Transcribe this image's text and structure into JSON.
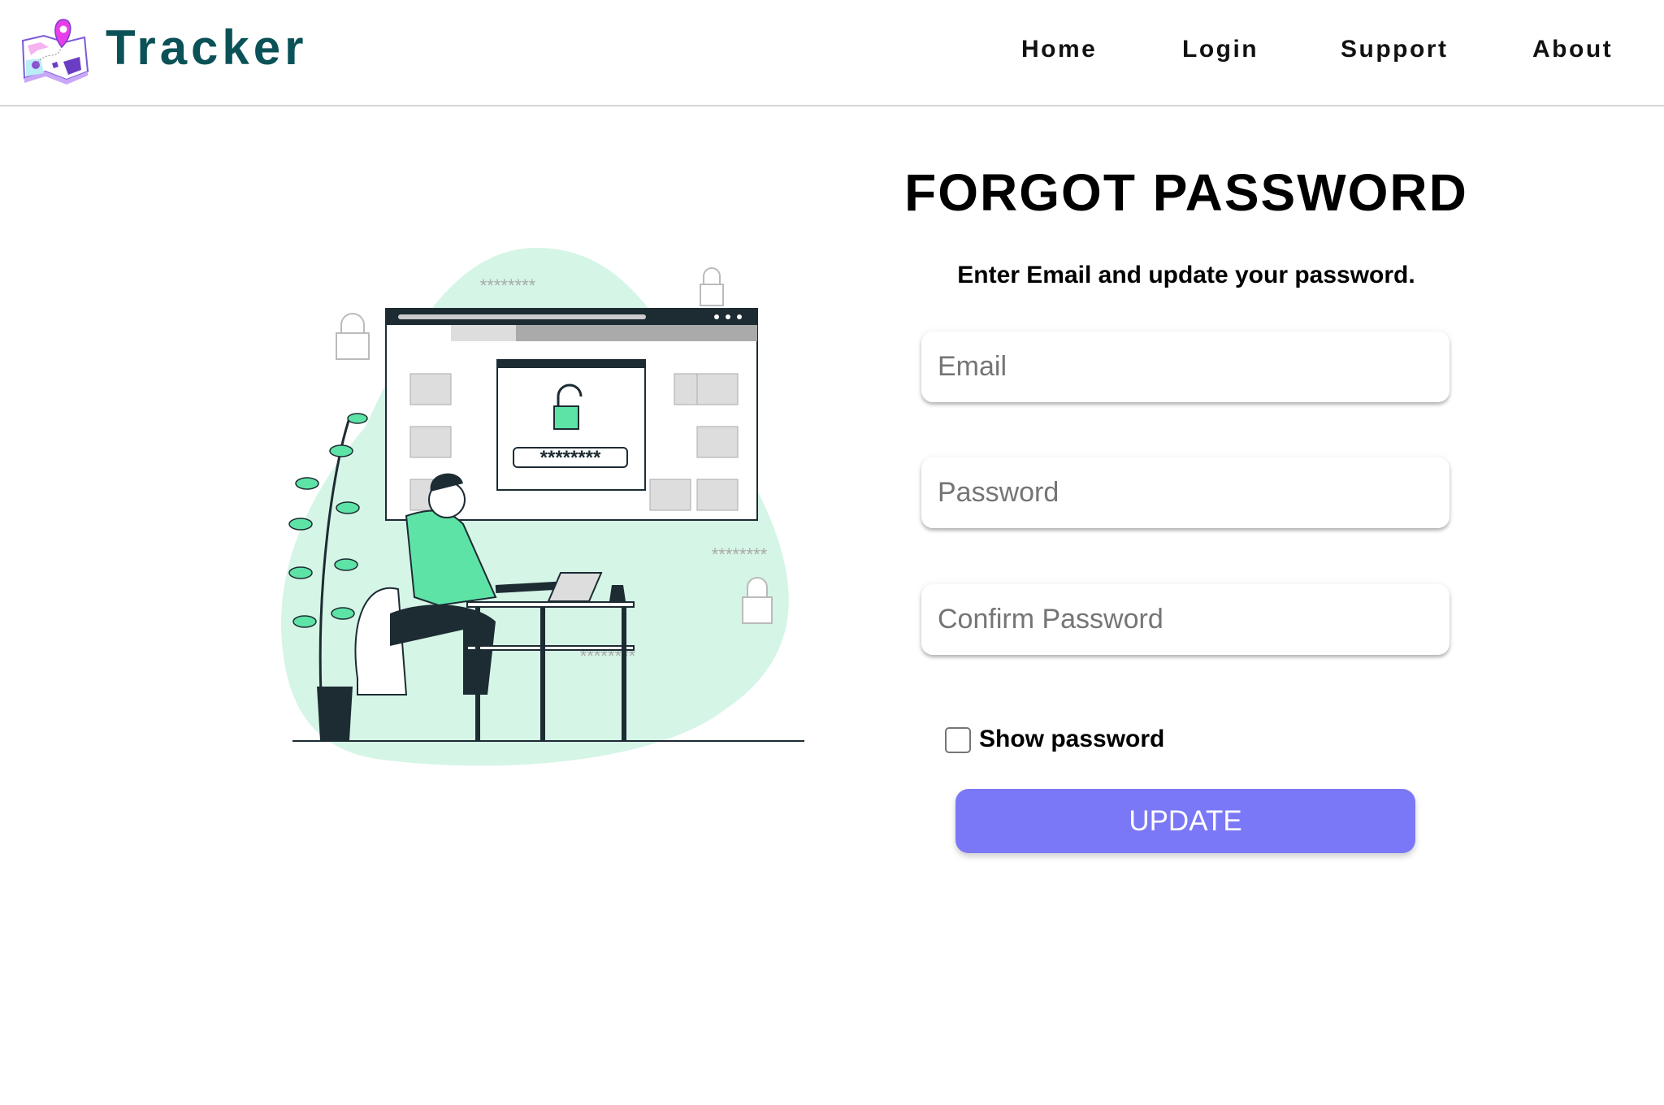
{
  "header": {
    "brand": "Tracker",
    "nav": [
      {
        "label": "Home"
      },
      {
        "label": "Login"
      },
      {
        "label": "Support"
      },
      {
        "label": "About"
      }
    ]
  },
  "illustration": {
    "password_mask": "********"
  },
  "form": {
    "title": "FORGOT PASSWORD",
    "subtitle": "Enter Email and update your password.",
    "email_placeholder": "Email",
    "password_placeholder": "Password",
    "confirm_placeholder": "Confirm Password",
    "show_password_label": "Show password",
    "show_password_checked": false,
    "submit_label": "UPDATE"
  },
  "colors": {
    "brand": "#0a5257",
    "accent": "#7b78f7",
    "illustration_green": "#5ee3a6"
  }
}
